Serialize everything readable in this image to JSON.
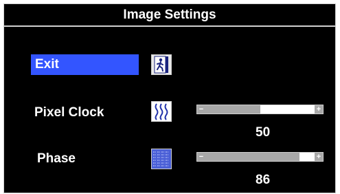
{
  "osd": {
    "title": "Image Settings",
    "exit": {
      "label": "Exit",
      "selected": true,
      "icon": "exit-person-icon"
    },
    "pixel_clock": {
      "label": "Pixel Clock",
      "value": "50",
      "level": 0.5,
      "icon": "wave-lines-icon"
    },
    "phase": {
      "label": "Phase",
      "value": "86",
      "level": 0.86,
      "icon": "noise-pattern-icon"
    }
  },
  "colors": {
    "background": "#000000",
    "highlight": "#3355ff",
    "slider_fill": "#a8a8a8",
    "text": "#ffffff"
  }
}
